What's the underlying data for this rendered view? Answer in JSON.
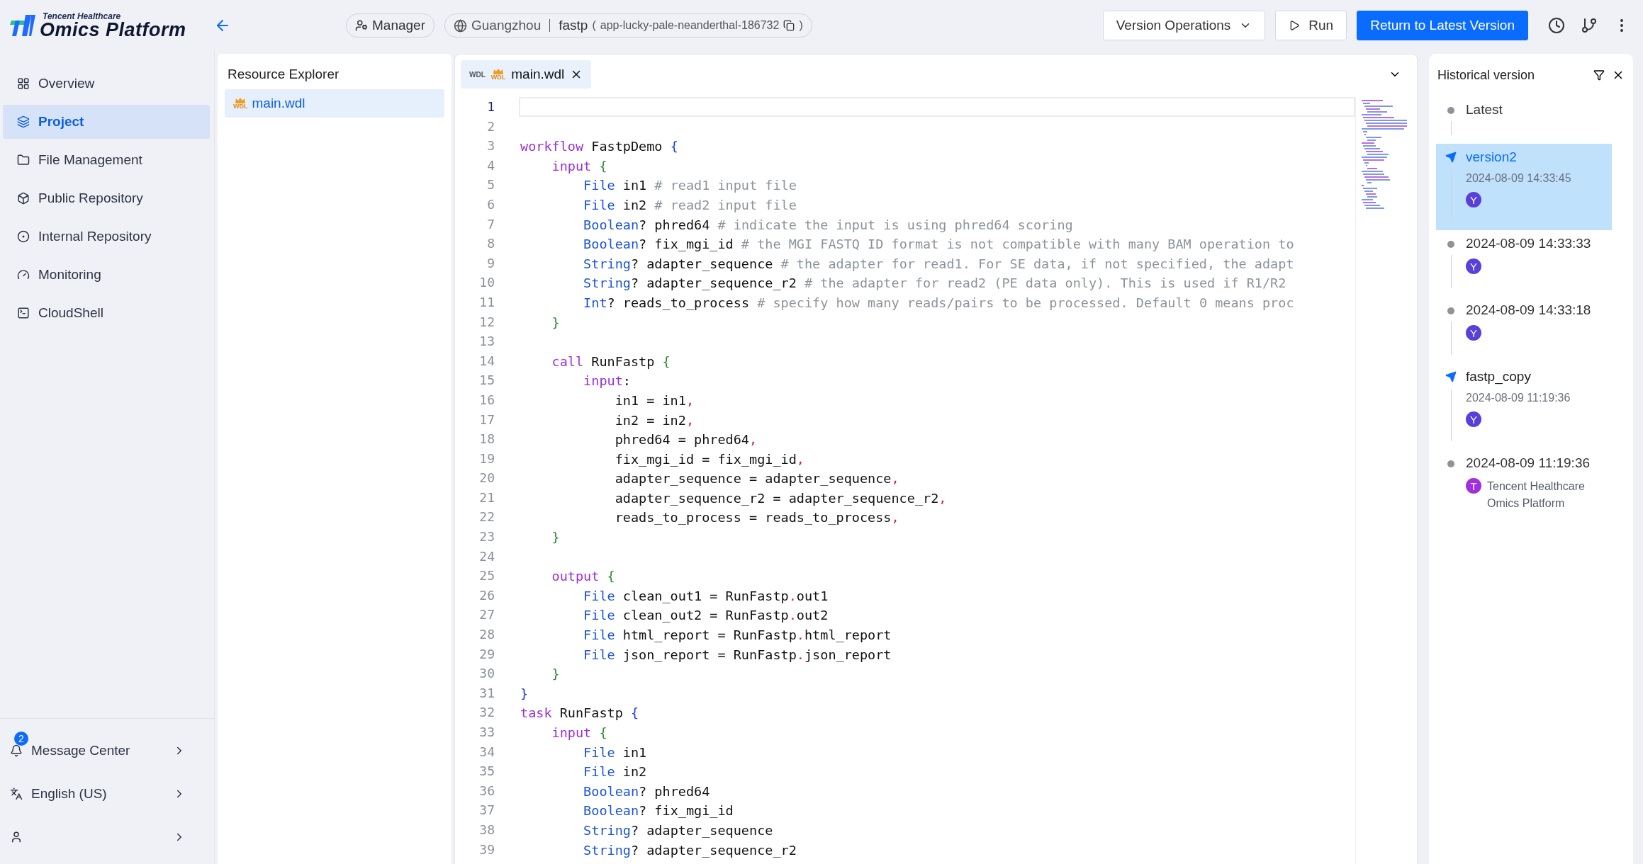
{
  "header": {
    "logo_tagline": "Tencent Healthcare",
    "logo_title": "Omics Platform",
    "role": "Manager",
    "region": "Guangzhou",
    "project": "fastp",
    "paren_open": "(",
    "app_id": "app-lucky-pale-neanderthal-186732",
    "paren_close": ")",
    "actions": [
      {
        "kind": "dropdown",
        "label": "Version Operations"
      },
      {
        "kind": "run",
        "label": "Run"
      },
      {
        "kind": "primary",
        "label": "Return to Latest Version"
      }
    ]
  },
  "sidebar": {
    "nav": [
      {
        "label": "Overview",
        "selected": false
      },
      {
        "label": "Project",
        "selected": true
      },
      {
        "label": "File Management",
        "selected": false
      },
      {
        "label": "Public Repository",
        "selected": false
      },
      {
        "label": "Internal Repository",
        "selected": false
      },
      {
        "label": "Monitoring",
        "selected": false
      },
      {
        "label": "CloudShell",
        "selected": false
      }
    ],
    "footer": [
      {
        "label": "Message Center",
        "badge": "2"
      },
      {
        "label": "English (US)"
      }
    ]
  },
  "explorer": {
    "title": "Resource Explorer",
    "files": [
      {
        "name": "main.wdl",
        "icon_label": "WDL",
        "selected": true
      }
    ]
  },
  "editor": {
    "tabs": [
      {
        "name": "main.wdl",
        "type_label": "WDL",
        "icon_label": "WDL",
        "selected": true
      }
    ],
    "lines": [
      {
        "number": "1",
        "active": true
      },
      {
        "number": "2",
        "active": false
      },
      {
        "number": "3",
        "active": false,
        "tokens": [
          {
            "kind": "kw",
            "text": "workflow"
          },
          {
            "kind": "plain",
            "text": " FastpDemo"
          },
          {
            "kind": "brace1",
            "text": " {"
          }
        ]
      },
      {
        "number": "4",
        "active": false,
        "tokens": [
          {
            "kind": "kw",
            "text": "    input"
          },
          {
            "kind": "brace2",
            "text": " {"
          }
        ]
      },
      {
        "number": "5",
        "active": false,
        "tokens": [
          {
            "kind": "type",
            "text": "        File"
          },
          {
            "kind": "plain",
            "text": " in1"
          },
          {
            "kind": "comment",
            "text": " # read1 input file"
          }
        ]
      },
      {
        "number": "6",
        "active": false,
        "tokens": [
          {
            "kind": "type",
            "text": "        File"
          },
          {
            "kind": "plain",
            "text": " in2"
          },
          {
            "kind": "comment",
            "text": " # read2 input file"
          }
        ]
      },
      {
        "number": "7",
        "active": false,
        "tokens": [
          {
            "kind": "type",
            "text": "        Boolean"
          },
          {
            "kind": "plain",
            "text": "? phred64"
          },
          {
            "kind": "comment",
            "text": " # indicate the input is using phred64 scoring"
          }
        ]
      },
      {
        "number": "8",
        "active": false,
        "tokens": [
          {
            "kind": "type",
            "text": "        Boolean"
          },
          {
            "kind": "plain",
            "text": "? fix_mgi_id"
          },
          {
            "kind": "comment",
            "text": " # the MGI FASTQ ID format is not compatible with many BAM operation to"
          }
        ]
      },
      {
        "number": "9",
        "active": false,
        "tokens": [
          {
            "kind": "type",
            "text": "        String"
          },
          {
            "kind": "plain",
            "text": "? adapter_sequence"
          },
          {
            "kind": "comment",
            "text": " # the adapter for read1. For SE data, if not specified, the adapt"
          }
        ]
      },
      {
        "number": "10",
        "active": false,
        "tokens": [
          {
            "kind": "type",
            "text": "        String"
          },
          {
            "kind": "plain",
            "text": "? adapter_sequence_r2"
          },
          {
            "kind": "comment",
            "text": " # the adapter for read2 (PE data only). This is used if R1/R2"
          }
        ]
      },
      {
        "number": "11",
        "active": false,
        "tokens": [
          {
            "kind": "type",
            "text": "        Int"
          },
          {
            "kind": "plain",
            "text": "? reads_to_process"
          },
          {
            "kind": "comment",
            "text": " # specify how many reads/pairs to be processed. Default 0 means proc"
          }
        ]
      },
      {
        "number": "12",
        "active": false,
        "tokens": [
          {
            "kind": "brace2",
            "text": "    }"
          }
        ]
      },
      {
        "number": "13",
        "active": false
      },
      {
        "number": "14",
        "active": false,
        "tokens": [
          {
            "kind": "kw",
            "text": "    call"
          },
          {
            "kind": "plain",
            "text": " RunFastp"
          },
          {
            "kind": "brace2",
            "text": " {"
          }
        ]
      },
      {
        "number": "15",
        "active": false,
        "tokens": [
          {
            "kind": "kw",
            "text": "        input"
          },
          {
            "kind": "plain",
            "text": ":"
          }
        ]
      },
      {
        "number": "16",
        "active": false,
        "tokens": [
          {
            "kind": "plain",
            "text": "            in1 = in1"
          },
          {
            "kind": "punct",
            "text": ","
          }
        ]
      },
      {
        "number": "17",
        "active": false,
        "tokens": [
          {
            "kind": "plain",
            "text": "            in2 = in2"
          },
          {
            "kind": "punct",
            "text": ","
          }
        ]
      },
      {
        "number": "18",
        "active": false,
        "tokens": [
          {
            "kind": "plain",
            "text": "            phred64 = phred64"
          },
          {
            "kind": "punct",
            "text": ","
          }
        ]
      },
      {
        "number": "19",
        "active": false,
        "tokens": [
          {
            "kind": "plain",
            "text": "            fix_mgi_id = fix_mgi_id"
          },
          {
            "kind": "punct",
            "text": ","
          }
        ]
      },
      {
        "number": "20",
        "active": false,
        "tokens": [
          {
            "kind": "plain",
            "text": "            adapter_sequence = adapter_sequence"
          },
          {
            "kind": "punct",
            "text": ","
          }
        ]
      },
      {
        "number": "21",
        "active": false,
        "tokens": [
          {
            "kind": "plain",
            "text": "            adapter_sequence_r2 = adapter_sequence_r2"
          },
          {
            "kind": "punct",
            "text": ","
          }
        ]
      },
      {
        "number": "22",
        "active": false,
        "tokens": [
          {
            "kind": "plain",
            "text": "            reads_to_process = reads_to_process"
          },
          {
            "kind": "punct",
            "text": ","
          }
        ]
      },
      {
        "number": "23",
        "active": false,
        "tokens": [
          {
            "kind": "brace2",
            "text": "    }"
          }
        ]
      },
      {
        "number": "24",
        "active": false
      },
      {
        "number": "25",
        "active": false,
        "tokens": [
          {
            "kind": "kw",
            "text": "    output"
          },
          {
            "kind": "brace2",
            "text": " {"
          }
        ]
      },
      {
        "number": "26",
        "active": false,
        "tokens": [
          {
            "kind": "type",
            "text": "        File"
          },
          {
            "kind": "plain",
            "text": " clean_out1 = RunFastp"
          },
          {
            "kind": "punct",
            "text": "."
          },
          {
            "kind": "plain",
            "text": "out1"
          }
        ]
      },
      {
        "number": "27",
        "active": false,
        "tokens": [
          {
            "kind": "type",
            "text": "        File"
          },
          {
            "kind": "plain",
            "text": " clean_out2 = RunFastp"
          },
          {
            "kind": "punct",
            "text": "."
          },
          {
            "kind": "plain",
            "text": "out2"
          }
        ]
      },
      {
        "number": "28",
        "active": false,
        "tokens": [
          {
            "kind": "type",
            "text": "        File"
          },
          {
            "kind": "plain",
            "text": " html_report = RunFastp"
          },
          {
            "kind": "punct",
            "text": "."
          },
          {
            "kind": "plain",
            "text": "html_report"
          }
        ]
      },
      {
        "number": "29",
        "active": false,
        "tokens": [
          {
            "kind": "type",
            "text": "        File"
          },
          {
            "kind": "plain",
            "text": " json_report = RunFastp"
          },
          {
            "kind": "punct",
            "text": "."
          },
          {
            "kind": "plain",
            "text": "json_report"
          }
        ]
      },
      {
        "number": "30",
        "active": false,
        "tokens": [
          {
            "kind": "brace2",
            "text": "    }"
          }
        ]
      },
      {
        "number": "31",
        "active": false,
        "tokens": [
          {
            "kind": "brace1",
            "text": "}"
          }
        ]
      },
      {
        "number": "32",
        "active": false,
        "tokens": [
          {
            "kind": "kw",
            "text": "task"
          },
          {
            "kind": "plain",
            "text": " RunFastp"
          },
          {
            "kind": "brace1",
            "text": " {"
          }
        ]
      },
      {
        "number": "33",
        "active": false,
        "tokens": [
          {
            "kind": "kw",
            "text": "    input"
          },
          {
            "kind": "brace2",
            "text": " {"
          }
        ]
      },
      {
        "number": "34",
        "active": false,
        "tokens": [
          {
            "kind": "type",
            "text": "        File"
          },
          {
            "kind": "plain",
            "text": " in1"
          }
        ]
      },
      {
        "number": "35",
        "active": false,
        "tokens": [
          {
            "kind": "type",
            "text": "        File"
          },
          {
            "kind": "plain",
            "text": " in2"
          }
        ]
      },
      {
        "number": "36",
        "active": false,
        "tokens": [
          {
            "kind": "type",
            "text": "        Boolean"
          },
          {
            "kind": "plain",
            "text": "? phred64"
          }
        ]
      },
      {
        "number": "37",
        "active": false,
        "tokens": [
          {
            "kind": "type",
            "text": "        Boolean"
          },
          {
            "kind": "plain",
            "text": "? fix_mgi_id"
          }
        ]
      },
      {
        "number": "38",
        "active": false,
        "tokens": [
          {
            "kind": "type",
            "text": "        String"
          },
          {
            "kind": "plain",
            "text": "? adapter_sequence"
          }
        ]
      },
      {
        "number": "39",
        "active": false,
        "tokens": [
          {
            "kind": "type",
            "text": "        String"
          },
          {
            "kind": "plain",
            "text": "? adapter_sequence_r2"
          }
        ]
      }
    ]
  },
  "history": {
    "title": "Historical version",
    "versions": [
      {
        "kind": "marker",
        "label": "Latest",
        "selected": false
      },
      {
        "kind": "tag",
        "name": "version2",
        "date": "2024-08-09 14:33:45",
        "avatar": "Y",
        "color": "#5a3fd8",
        "selected": true
      },
      {
        "kind": "auto",
        "date": "2024-08-09 14:33:33",
        "avatar": "Y",
        "color": "#5a3fd8",
        "selected": false
      },
      {
        "kind": "auto",
        "date": "2024-08-09 14:33:18",
        "avatar": "Y",
        "color": "#5a3fd8",
        "selected": false
      },
      {
        "kind": "tag",
        "name": "fastp_copy",
        "date": "2024-08-09 11:19:36",
        "avatar": "Y",
        "color": "#5a3fd8",
        "selected": false
      },
      {
        "kind": "auto",
        "date": "2024-08-09 11:19:36",
        "avatar": "T",
        "color": "#a12ee0",
        "user": "Tencent Healthcare Omics Platform",
        "selected": false
      }
    ]
  }
}
